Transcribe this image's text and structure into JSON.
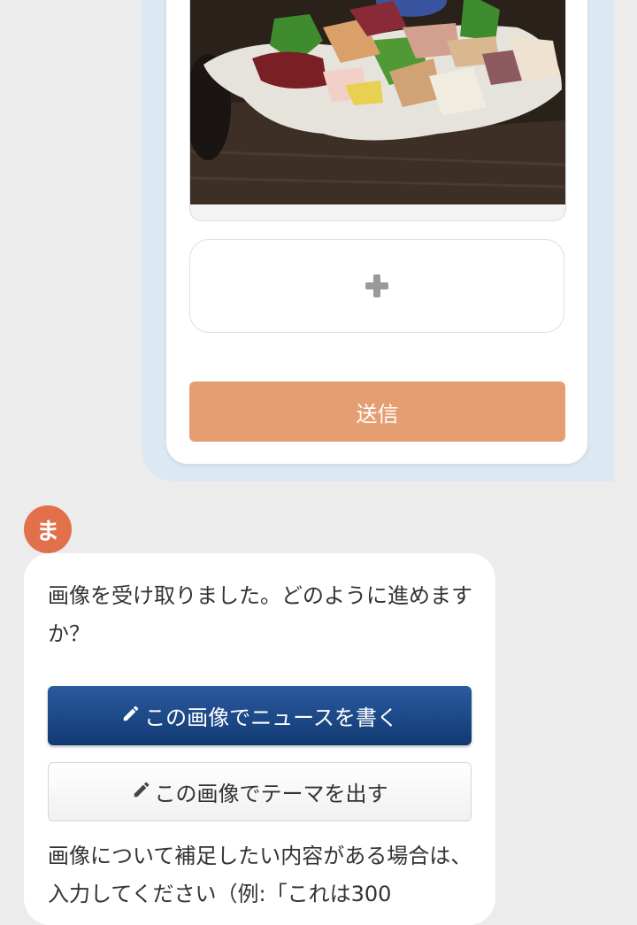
{
  "upload": {
    "send_label": "送信"
  },
  "bot": {
    "avatar_initial": "ま",
    "message": "画像を受け取りました。どのように進めますか？",
    "news_button_label": "この画像でニュースを書く",
    "theme_button_label": "この画像でテーマを出す",
    "hint": "画像について補足したい内容がある場合は、入力してください（例:「これは300"
  },
  "icons": {
    "add": "plus-icon",
    "pencil": "pencil-icon"
  },
  "colors": {
    "send_button": "#e59e72",
    "news_button": "#1d4a8a",
    "avatar": "#e2704b",
    "user_bubble": "#dde9f2"
  }
}
